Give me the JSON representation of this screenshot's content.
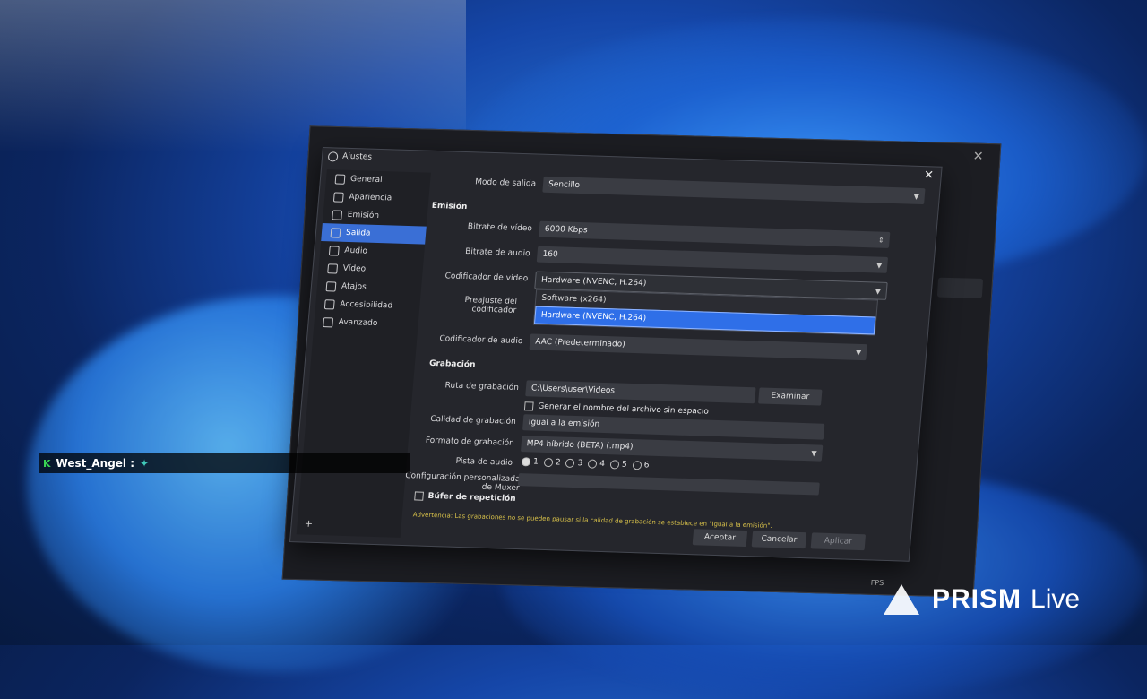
{
  "dialog": {
    "title": "Ajustes",
    "close": "✕"
  },
  "sidebar": {
    "items": [
      {
        "label": "General"
      },
      {
        "label": "Apariencia"
      },
      {
        "label": "Emisión"
      },
      {
        "label": "Salida"
      },
      {
        "label": "Audio"
      },
      {
        "label": "Vídeo"
      },
      {
        "label": "Atajos"
      },
      {
        "label": "Accesibilidad"
      },
      {
        "label": "Avanzado"
      }
    ],
    "active": "Salida",
    "add": "+"
  },
  "output": {
    "mode_label": "Modo de salida",
    "mode_value": "Sencillo"
  },
  "streaming": {
    "title": "Emisión",
    "video_bitrate_label": "Bitrate de vídeo",
    "video_bitrate_value": "6000 Kbps",
    "audio_bitrate_label": "Bitrate de audio",
    "audio_bitrate_value": "160",
    "video_encoder_label": "Codificador de vídeo",
    "video_encoder_value": "Hardware (NVENC, H.264)",
    "preset_label": "Preajuste del codificador",
    "audio_encoder_label": "Codificador de audio",
    "audio_encoder_value": "AAC (Predeterminado)",
    "encoder_options": [
      "Software (x264)",
      "Hardware (NVENC, H.264)"
    ],
    "encoder_selected": "Hardware (NVENC, H.264)"
  },
  "recording": {
    "title": "Grabación",
    "path_label": "Ruta de grabación",
    "path_value": "C:\\Users\\user\\Videos",
    "browse": "Examinar",
    "nospace_label": "Generar el nombre del archivo sin espacio",
    "quality_label": "Calidad de grabación",
    "quality_value": "Igual a la emisión",
    "format_label": "Formato de grabación",
    "format_value": "MP4 híbrido (BETA) (.mp4)",
    "track_label": "Pista de audio",
    "tracks": [
      "1",
      "2",
      "3",
      "4",
      "5",
      "6"
    ],
    "muxer_label": "Configuración personalizada de Muxer",
    "replay_label": "Búfer de repetición",
    "warning": "Advertencia: Las grabaciones no se pueden pausar si la calidad de grabación se establece en \"Igual a la emisión\"."
  },
  "buttons": {
    "accept": "Aceptar",
    "cancel": "Cancelar",
    "apply": "Aplicar"
  },
  "chat": {
    "user": "West_Angel :"
  },
  "watermark": {
    "name": "PRISM",
    "suffix": "Live"
  },
  "behind": {
    "fps": "FPS"
  }
}
